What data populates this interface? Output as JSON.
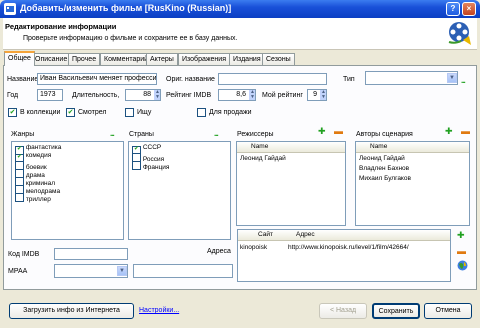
{
  "window": {
    "title": "Добавить/изменить фильм [RusKino (Russian)]"
  },
  "header": {
    "title": "Редактирование информации",
    "subtitle": "Проверьте информацию о фильме и сохраните ее в базу данных."
  },
  "tabs": [
    "Общее",
    "Описание",
    "Прочее",
    "Комментарий",
    "Актеры",
    "Изображения",
    "Издания",
    "Сезоны"
  ],
  "form": {
    "title_label": "Название",
    "title_value": "Иван Васильевич меняет профессию",
    "orig_label": "Ориг. название",
    "orig_value": "",
    "type_label": "Тип",
    "type_value": "",
    "year_label": "Год",
    "year_value": "1973",
    "duration_label": "Длительность,",
    "duration_value": "88",
    "imdb_rating_label": "Рейтинг IMDB",
    "imdb_rating_value": "8,6",
    "my_rating_label": "Мой рейтинг",
    "my_rating_value": "9",
    "in_collection_label": "В коллекции",
    "seen_label": "Смотрел",
    "wanted_label": "Ищу",
    "for_sale_label": "Для продажи",
    "imdb_code_label": "Код IMDB",
    "imdb_code_value": "",
    "mpaa_label": "MPAA",
    "mpaa_value": "",
    "addresses_label": "Адреса"
  },
  "genres": {
    "label": "Жанры",
    "items": [
      {
        "label": "фантастика",
        "checked": true
      },
      {
        "label": "комедия",
        "checked": true
      },
      {
        "label": "боевик",
        "checked": false
      },
      {
        "label": "драма",
        "checked": false
      },
      {
        "label": "криминал",
        "checked": false
      },
      {
        "label": "мелодрама",
        "checked": false
      },
      {
        "label": "триллер",
        "checked": false
      }
    ]
  },
  "countries": {
    "label": "Страны",
    "items": [
      {
        "label": "СССР",
        "checked": true
      },
      {
        "label": "Россия",
        "checked": false
      },
      {
        "label": "Франция",
        "checked": false
      }
    ]
  },
  "directors": {
    "label": "Режиссеры",
    "column": "Name",
    "items": [
      "Леонид Гайдай"
    ]
  },
  "writers": {
    "label": "Авторы сценария",
    "column": "Name",
    "items": [
      "Леонид Гайдай",
      "Владлен Бахнов",
      "Михаил Булгаков"
    ]
  },
  "sites": {
    "columns": [
      "Сайт",
      "Адрес"
    ],
    "rows": [
      {
        "site": "kinopoisk",
        "url": "http://www.kinopoisk.ru/level/1/film/42664/"
      }
    ]
  },
  "buttons": {
    "load_internet": "Загрузить инфо из Интернета",
    "settings": "Настройки...",
    "back": "< Назад",
    "save": "Сохранить",
    "cancel": "Отмена"
  },
  "icons": {
    "add": "plus-icon",
    "remove": "minus-icon",
    "more": "ellipsis-icon",
    "globe": "globe-icon",
    "film_reel": "film-reel-icon"
  }
}
